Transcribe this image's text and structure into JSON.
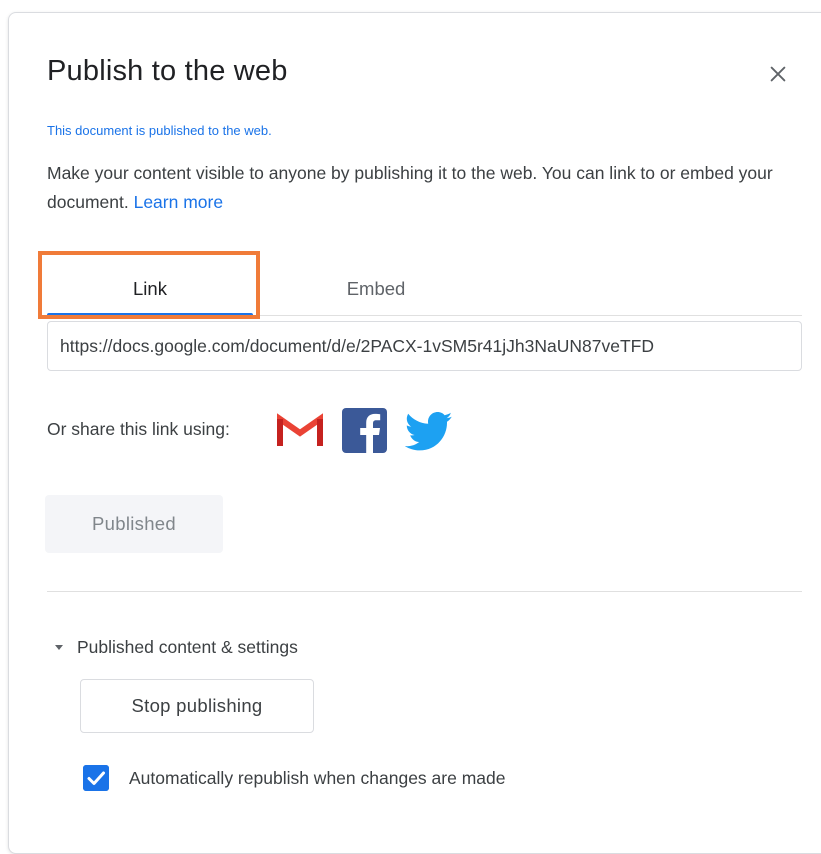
{
  "dialog": {
    "title": "Publish to the web",
    "status_message": "This document is published to the web.",
    "description": "Make your content visible to anyone by publishing it to the web. You can link to or embed your document.",
    "learn_more_label": "Learn more",
    "close_icon": "close-icon"
  },
  "tabs": {
    "link_label": "Link",
    "embed_label": "Embed",
    "active": "Link"
  },
  "link": {
    "url": "https://docs.google.com/document/d/e/2PACX-1vSM5r41jJh3NaUN87veTFD",
    "share_label": "Or share this link using:",
    "share_icons": [
      "gmail-icon",
      "facebook-icon",
      "twitter-icon"
    ]
  },
  "publish": {
    "published_label": "Published"
  },
  "settings": {
    "section_label": "Published content & settings",
    "stop_publishing_label": "Stop publishing",
    "auto_republish_label": "Automatically republish when changes are made",
    "auto_republish_checked": true
  },
  "colors": {
    "accent": "#1a73e8",
    "highlight": "#f07b39",
    "gmail_red": "#ea4335",
    "facebook_blue": "#3b5998",
    "twitter_blue": "#1da1f2"
  }
}
